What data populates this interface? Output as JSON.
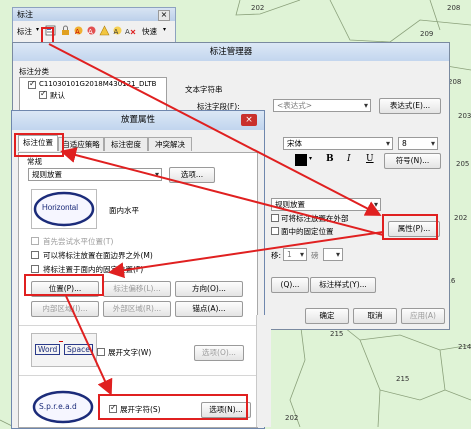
{
  "map": {
    "numbers": [
      "202",
      "208",
      "209",
      "208",
      "203",
      "205",
      "202",
      "216",
      "215",
      "214",
      "215",
      "202"
    ]
  },
  "toolbar": {
    "title": "标注",
    "menu_label": "标注",
    "quick_label": "快速",
    "close_symbol": "×"
  },
  "manager": {
    "title": "标注管理器",
    "class_section_label": "标注分类",
    "tree_layer": "C11030101G2018M430121_DLTB",
    "tree_default": "默认",
    "text_string_label": "文本字符串",
    "label_field_label": "标注字段(F):",
    "label_field_value": "<表达式>",
    "expression_button": "表达式(E)...",
    "font_value": "宋体",
    "size_value": "8",
    "symbol_button": "符号(N)...",
    "bold": "B",
    "italic": "I",
    "underline": "U",
    "placement_combo": "规则放置",
    "can_place_outside": "可将标注放置在外部",
    "fixed_position": "面中的固定位置",
    "offset_label": "移:",
    "offset_value": "1",
    "offset_unit": "磅",
    "properties_button": "属性(P)...",
    "query_button": "(Q)...",
    "label_style_button": "标注样式(Y)...",
    "ok_button": "确定",
    "cancel_button": "取消",
    "apply_button": "应用(A)"
  },
  "placement": {
    "title": "放置属性",
    "close_symbol": "×",
    "tabs": [
      "标注位置",
      "自适应策略",
      "标注密度",
      "冲突解决"
    ],
    "regular_label": "常规",
    "regular_combo": "规则放置",
    "options_button": "选项...",
    "horizontal_preview": "Horizontal",
    "horizontal_text": "面内水平",
    "first_horizontal": "首先尝试水平位置(T)",
    "allow_outside": "可以将标注放置在面边界之外(M)",
    "place_inside_fixed": "将标注置于面内的固定位置(F)",
    "position_button": "位置(P)...",
    "offset_button": "标注偏移(L)...",
    "direction_button": "方向(O)...",
    "inner_zone_button": "内部区域(I)...",
    "outer_zone_button": "外部区域(R)...",
    "anchor_button": "锚点(A)...",
    "word_preview": "Word",
    "space_preview": "Space",
    "spread_words": "展开文字(W)",
    "options2_button": "选项(O)...",
    "char_preview": "S.p.r.e.a.d",
    "spread_chars": "展开字符(S)",
    "options3_button": "选项(N)..."
  }
}
